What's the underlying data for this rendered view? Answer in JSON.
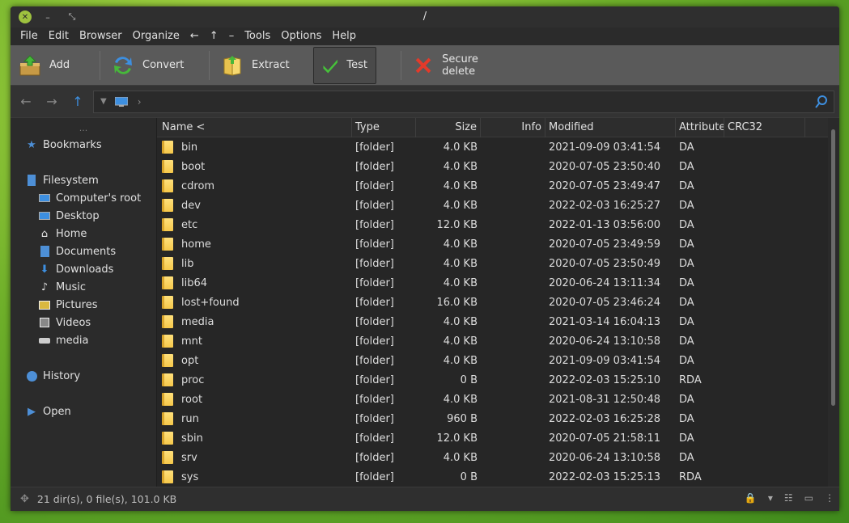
{
  "window": {
    "title": "/"
  },
  "menu": [
    "File",
    "Edit",
    "Browser",
    "Organize",
    "←",
    "↑",
    "–",
    "Tools",
    "Options",
    "Help"
  ],
  "toolbar": {
    "add": "Add",
    "convert": "Convert",
    "extract": "Extract",
    "test": "Test",
    "secure_delete": "Secure delete"
  },
  "sidebar": {
    "dots": "...",
    "bookmarks": "Bookmarks",
    "filesystem": "Filesystem",
    "items": [
      "Computer's root",
      "Desktop",
      "Home",
      "Documents",
      "Downloads",
      "Music",
      "Pictures",
      "Videos",
      "media"
    ],
    "history": "History",
    "open": "Open"
  },
  "columns": {
    "name": "Name <",
    "type": "Type",
    "size": "Size",
    "info": "Info",
    "modified": "Modified",
    "attributes": "Attributes",
    "crc32": "CRC32"
  },
  "rows": [
    {
      "name": "bin",
      "type": "[folder]",
      "size": "4.0 KB",
      "modified": "2021-09-09 03:41:54",
      "attr": "DA"
    },
    {
      "name": "boot",
      "type": "[folder]",
      "size": "4.0 KB",
      "modified": "2020-07-05 23:50:40",
      "attr": "DA"
    },
    {
      "name": "cdrom",
      "type": "[folder]",
      "size": "4.0 KB",
      "modified": "2020-07-05 23:49:47",
      "attr": "DA"
    },
    {
      "name": "dev",
      "type": "[folder]",
      "size": "4.0 KB",
      "modified": "2022-02-03 16:25:27",
      "attr": "DA"
    },
    {
      "name": "etc",
      "type": "[folder]",
      "size": "12.0 KB",
      "modified": "2022-01-13 03:56:00",
      "attr": "DA"
    },
    {
      "name": "home",
      "type": "[folder]",
      "size": "4.0 KB",
      "modified": "2020-07-05 23:49:59",
      "attr": "DA"
    },
    {
      "name": "lib",
      "type": "[folder]",
      "size": "4.0 KB",
      "modified": "2020-07-05 23:50:49",
      "attr": "DA"
    },
    {
      "name": "lib64",
      "type": "[folder]",
      "size": "4.0 KB",
      "modified": "2020-06-24 13:11:34",
      "attr": "DA"
    },
    {
      "name": "lost+found",
      "type": "[folder]",
      "size": "16.0 KB",
      "modified": "2020-07-05 23:46:24",
      "attr": "DA"
    },
    {
      "name": "media",
      "type": "[folder]",
      "size": "4.0 KB",
      "modified": "2021-03-14 16:04:13",
      "attr": "DA"
    },
    {
      "name": "mnt",
      "type": "[folder]",
      "size": "4.0 KB",
      "modified": "2020-06-24 13:10:58",
      "attr": "DA"
    },
    {
      "name": "opt",
      "type": "[folder]",
      "size": "4.0 KB",
      "modified": "2021-09-09 03:41:54",
      "attr": "DA"
    },
    {
      "name": "proc",
      "type": "[folder]",
      "size": "0 B",
      "modified": "2022-02-03 15:25:10",
      "attr": "RDA"
    },
    {
      "name": "root",
      "type": "[folder]",
      "size": "4.0 KB",
      "modified": "2021-08-31 12:50:48",
      "attr": "DA"
    },
    {
      "name": "run",
      "type": "[folder]",
      "size": "960 B",
      "modified": "2022-02-03 16:25:28",
      "attr": "DA"
    },
    {
      "name": "sbin",
      "type": "[folder]",
      "size": "12.0 KB",
      "modified": "2020-07-05 21:58:11",
      "attr": "DA"
    },
    {
      "name": "srv",
      "type": "[folder]",
      "size": "4.0 KB",
      "modified": "2020-06-24 13:10:58",
      "attr": "DA"
    },
    {
      "name": "sys",
      "type": "[folder]",
      "size": "0 B",
      "modified": "2022-02-03 15:25:13",
      "attr": "RDA"
    }
  ],
  "status": {
    "text": "21 dir(s), 0 file(s), 101.0 KB"
  },
  "colors": {
    "accent": "#3d8fe0",
    "folder": "#f6c84a",
    "toolbar": "#5a5a5a",
    "window_bg": "#2b2b2b"
  },
  "icons": [
    "close-icon",
    "minimize-icon",
    "maximize-icon",
    "add-icon",
    "convert-icon",
    "extract-icon",
    "test-icon",
    "secure-delete-icon",
    "back-icon",
    "forward-icon",
    "up-icon",
    "computer-icon",
    "search-icon",
    "star-icon",
    "drive-icon",
    "folder-icon",
    "lock-icon"
  ]
}
